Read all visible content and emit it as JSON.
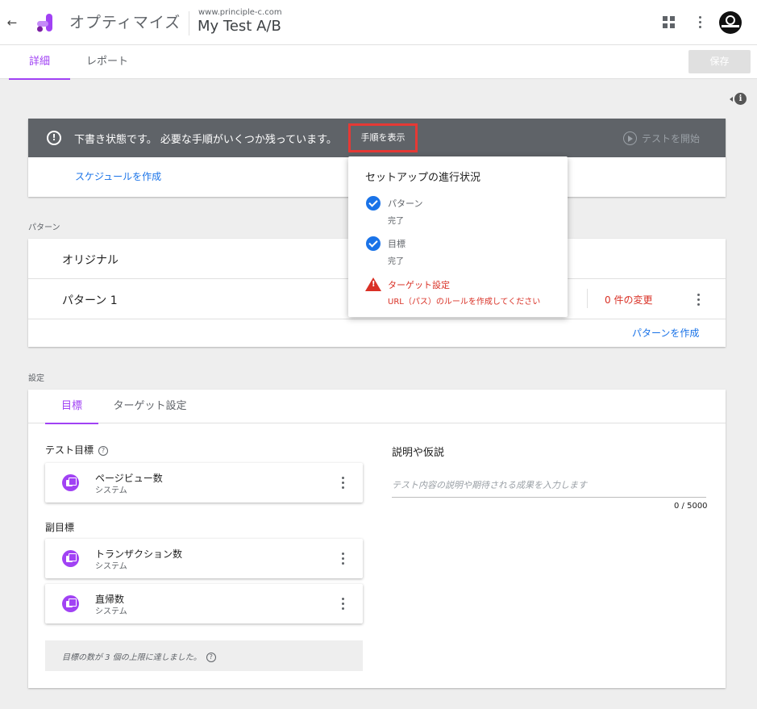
{
  "header": {
    "back_icon": "arrow-left-icon",
    "app_name": "オプティマイズ",
    "container_url": "www.principle-c.com",
    "experiment_name": "My Test A/B",
    "apps_icon": "apps-grid-icon",
    "menu_icon": "more-vert-icon"
  },
  "tabs": {
    "details": "詳細",
    "report": "レポート",
    "save": "保存"
  },
  "draft": {
    "message": "下書き状態です。 必要な手順がいくつか残っています。",
    "show_steps": "手順を表示",
    "start_test": "テストを開始",
    "create_schedule": "スケジュールを作成"
  },
  "variants": {
    "section_label": "パターン",
    "original": "オリジナル",
    "variant1": "パターン 1",
    "variant1_changes": "0 件の変更",
    "create_variant": "パターンを作成"
  },
  "setup_popover": {
    "title": "セットアップの進行状況",
    "steps": [
      {
        "name": "パターン",
        "status": "完了",
        "state": "done"
      },
      {
        "name": "目標",
        "status": "完了",
        "state": "done"
      },
      {
        "name": "ターゲット設定",
        "status": "URL（パス）のルールを作成してください",
        "state": "warning"
      }
    ]
  },
  "settings": {
    "section_label": "設定",
    "tab_objectives": "目標",
    "tab_targeting": "ターゲット設定",
    "primary_label": "テスト目標",
    "primary_objective": {
      "name": "ページビュー数",
      "type": "システム"
    },
    "secondary_label": "副目標",
    "secondary_objectives": [
      {
        "name": "トランザクション数",
        "type": "システム"
      },
      {
        "name": "直帰数",
        "type": "システム"
      }
    ],
    "limit_message": "目標の数が 3 個の上限に達しました。",
    "description_title": "説明や仮説",
    "description_placeholder": "テスト内容の説明や期待される成果を入力します",
    "description_value": "",
    "char_counter": "0 / 5000"
  },
  "colors": {
    "accent": "#a142f4",
    "link": "#1a73e8",
    "error": "#d93025",
    "banner": "#5f6368",
    "highlight_box": "#e53935"
  }
}
